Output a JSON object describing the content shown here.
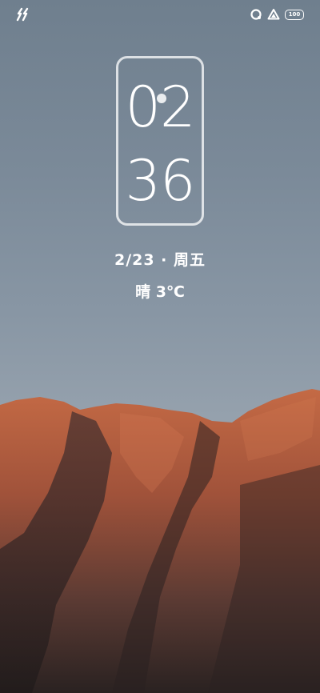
{
  "status_bar": {
    "left_icon": "signal-slash-icon",
    "right_icons": [
      "circle-status-icon",
      "triangle-status-icon"
    ],
    "battery_level": "100"
  },
  "clock": {
    "hours": "02",
    "minutes": "36"
  },
  "date": {
    "text": "2/23 · 周五"
  },
  "weather": {
    "text": "晴 3℃"
  },
  "colors": {
    "sky_top": "#6f7f8e",
    "sky_bottom": "#9aa5b0",
    "mountain_lit": "#b25e3f",
    "mountain_shadow": "#2e2422"
  }
}
